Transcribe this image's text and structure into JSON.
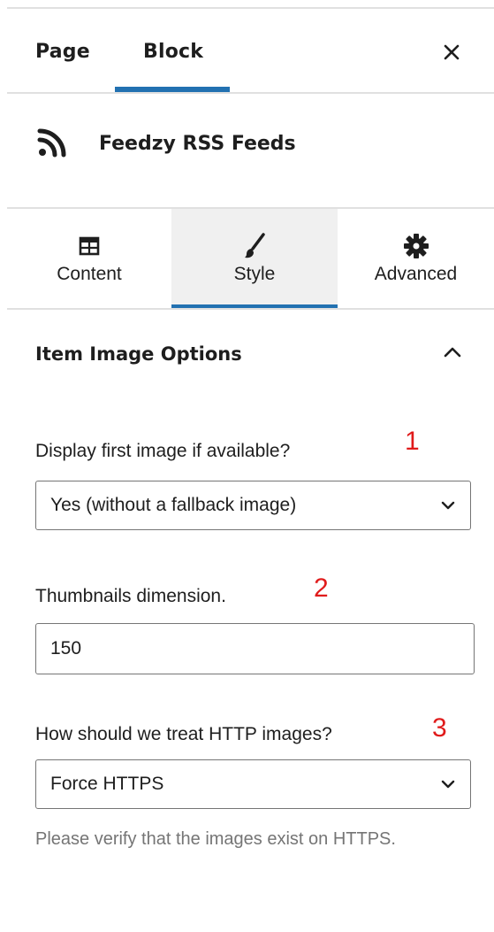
{
  "sidebar_tabs": [
    {
      "label": "Page",
      "active": false
    },
    {
      "label": "Block",
      "active": true
    }
  ],
  "accent_color": "#2271b1",
  "close_icon": "close-icon",
  "block": {
    "icon": "rss-icon",
    "title": "Feedzy RSS Feeds"
  },
  "inspector_tabs": [
    {
      "label": "Content",
      "icon": "table-icon",
      "active": false
    },
    {
      "label": "Style",
      "icon": "brush-icon",
      "active": true
    },
    {
      "label": "Advanced",
      "icon": "gear-icon",
      "active": false
    }
  ],
  "panel": {
    "title": "Item Image Options",
    "expanded": true
  },
  "fields": {
    "display_image": {
      "label": "Display first image if available?",
      "marker": "1",
      "value": "Yes (without a fallback image)"
    },
    "thumbnails": {
      "label": "Thumbnails dimension.",
      "marker": "2",
      "value": "150"
    },
    "http_images": {
      "label": "How should we treat HTTP images?",
      "marker": "3",
      "value": "Force HTTPS",
      "help": "Please verify that the images exist on HTTPS."
    }
  },
  "marker_color": "#e01b1b"
}
